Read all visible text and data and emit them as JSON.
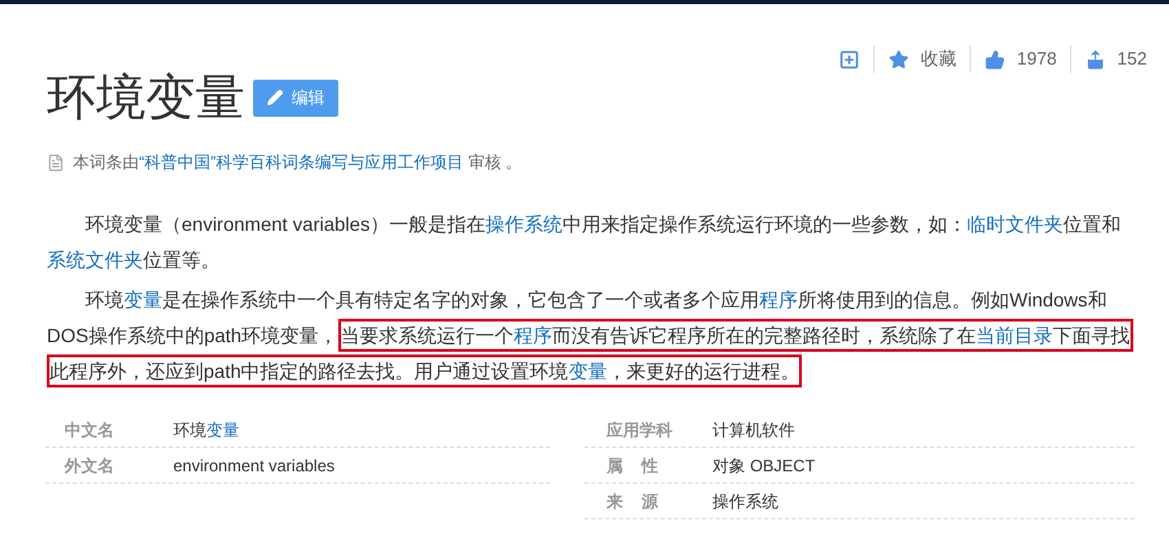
{
  "title": "环境变量",
  "edit_button": "编辑",
  "toolbar": [
    {
      "kind": "add"
    },
    {
      "kind": "star",
      "label": "收藏"
    },
    {
      "kind": "like",
      "label": "1978"
    },
    {
      "kind": "share",
      "label": "152"
    }
  ],
  "review_note": {
    "before": "本词条由",
    "link": "“科普中国”科学百科词条编写与应用工作项目",
    "after": " 审核 。"
  },
  "paragraphs": [
    [
      {
        "kind": "text",
        "text": "环境变量（environment variables）一般是指在"
      },
      {
        "kind": "link",
        "text": "操作系统"
      },
      {
        "kind": "text",
        "text": "中用来指定操作系统运行环境的一些参数，如："
      },
      {
        "kind": "link",
        "text": "临时文件夹"
      },
      {
        "kind": "text",
        "text": "位置和"
      },
      {
        "kind": "link",
        "text": "系统文件夹"
      },
      {
        "kind": "text",
        "text": "位置等。"
      }
    ],
    [
      {
        "kind": "text",
        "text": "环境"
      },
      {
        "kind": "link",
        "text": "变量"
      },
      {
        "kind": "text",
        "text": "是在操作系统中一个具有特定名字的对象，它包含了一个或者多个应用"
      },
      {
        "kind": "link",
        "text": "程序"
      },
      {
        "kind": "text",
        "text": "所将使用到的信息。例如Windows和DOS操作系统中的path环境变量，"
      },
      {
        "kind": "highlight",
        "parts": [
          {
            "kind": "text",
            "text": "当要求系统运行一个"
          },
          {
            "kind": "link",
            "text": "程序"
          },
          {
            "kind": "text",
            "text": "而没有告诉它程序所在的完整路径时，系统除了在"
          },
          {
            "kind": "link",
            "text": "当前目录"
          },
          {
            "kind": "text",
            "text": "下面寻找此程序外，还应到path中指定的路径去找。用户通过设置环境"
          },
          {
            "kind": "link",
            "text": "变量"
          },
          {
            "kind": "text",
            "text": "，来更好的运行进程。"
          }
        ]
      }
    ]
  ],
  "info_table": {
    "left": [
      {
        "label": "中文名",
        "value": [
          {
            "kind": "text",
            "text": "环境"
          },
          {
            "kind": "link",
            "text": "变量"
          }
        ]
      },
      {
        "label": "外文名",
        "value": [
          {
            "kind": "text",
            "text": "environment variables"
          }
        ]
      }
    ],
    "right": [
      {
        "label": "应用学科",
        "value": [
          {
            "kind": "text",
            "text": "计算机软件"
          }
        ]
      },
      {
        "label": "属    性",
        "value": [
          {
            "kind": "text",
            "text": "对象 OBJECT"
          }
        ]
      },
      {
        "label": "来    源",
        "value": [
          {
            "kind": "text",
            "text": "操作系统"
          }
        ]
      }
    ]
  }
}
